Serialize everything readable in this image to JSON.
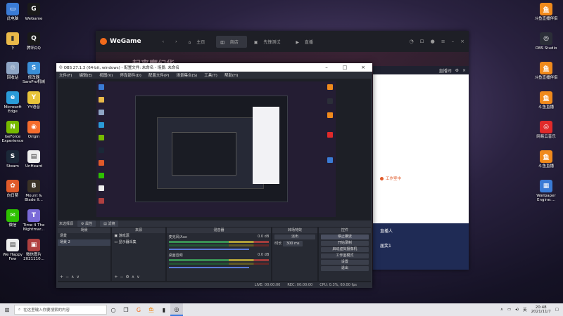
{
  "desktop_left_icons": [
    {
      "label": "此电脑",
      "icon": "computer-icon",
      "color": "#3a7bd5",
      "glyph": "▭"
    },
    {
      "label": "WeGame",
      "icon": "wegame-icon",
      "color": "#1a1a1a",
      "glyph": "G"
    },
    {
      "label": "下",
      "icon": "folder-icon",
      "color": "#e9b949",
      "glyph": "▮"
    },
    {
      "label": "腾讯QQ",
      "icon": "qq-icon",
      "color": "#1a1a1a",
      "glyph": "Q"
    },
    {
      "label": "回收站",
      "icon": "recycle-bin-icon",
      "color": "#8fa6c5",
      "glyph": "♲"
    },
    {
      "label": "修改器 SamPro机械",
      "icon": "tool-icon",
      "color": "#3a8fd8",
      "glyph": "S"
    },
    {
      "label": "Microsoft Edge",
      "icon": "edge-icon",
      "color": "#2a9bd8",
      "glyph": "e"
    },
    {
      "label": "YY语音",
      "icon": "yy-icon",
      "color": "#e8c43a",
      "glyph": "Y"
    },
    {
      "label": "GeForce Experience",
      "icon": "nvidia-icon",
      "color": "#76b900",
      "glyph": "N"
    },
    {
      "label": "Origin",
      "icon": "origin-icon",
      "color": "#f56c2d",
      "glyph": "◉"
    },
    {
      "label": "Steam",
      "icon": "steam-icon",
      "color": "#1b2838",
      "glyph": "S"
    },
    {
      "label": "UnHeard",
      "icon": "document-icon",
      "color": "#eeeeee",
      "glyph": "▤"
    },
    {
      "label": "向日葵",
      "icon": "sunflower-icon",
      "color": "#e05a2a",
      "glyph": "✿"
    },
    {
      "label": "Mount & Blade II...",
      "icon": "bannerlord-icon",
      "color": "#3a3226",
      "glyph": "B"
    },
    {
      "label": "微信",
      "icon": "wechat-icon",
      "color": "#2dc100",
      "glyph": "✉"
    },
    {
      "label": "Time 4 The Nightmar...",
      "icon": "game-icon",
      "color": "#7a6ad8",
      "glyph": "T"
    },
    {
      "label": "We Happy Few",
      "icon": "document-icon",
      "color": "#eeeeee",
      "glyph": "▤"
    },
    {
      "label": "微信图片 2021110...",
      "icon": "image-icon",
      "color": "#b04040",
      "glyph": "▣"
    }
  ],
  "desktop_right_icons": [
    {
      "label": "斗鱼直播伴侣",
      "icon": "douyu-icon",
      "color": "#f08a1c",
      "glyph": "鱼"
    },
    {
      "label": "OBS Studio",
      "icon": "obs-icon",
      "color": "#2b2e38",
      "glyph": "◎"
    },
    {
      "label": "斗鱼直播伴侣",
      "icon": "douyu-icon",
      "color": "#f08a1c",
      "glyph": "鱼"
    },
    {
      "label": "斗鱼直播",
      "icon": "douyu-icon",
      "color": "#f08a1c",
      "glyph": "鱼"
    },
    {
      "label": "网易云音乐",
      "icon": "netease-music-icon",
      "color": "#e02a2a",
      "glyph": "◎"
    },
    {
      "label": "斗鱼直播",
      "icon": "douyu-icon",
      "color": "#f08a1c",
      "glyph": "鱼"
    },
    {
      "label": "Wallpaper Engine:...",
      "icon": "wallpaper-engine-icon",
      "color": "#3a7bd5",
      "glyph": "▦"
    }
  ],
  "wegame": {
    "logo": "WeGame",
    "tabs": [
      "主页",
      "商店",
      "先锋测试",
      "直播"
    ],
    "active_tab": "商店",
    "banner": "一起来魔幻华"
  },
  "live_panel": {
    "status": "工作室中",
    "menu": [
      "直播人",
      "届奖1"
    ]
  },
  "obs": {
    "title": "OBS 27.1.3 (64-bit, windows) - 配置文件: 未命名 - 场景: 未命名",
    "menu": [
      "文件(F)",
      "编辑(E)",
      "视图(V)",
      "停靠部件(D)",
      "配置文件(P)",
      "场景集合(S)",
      "工具(T)",
      "帮助(H)"
    ],
    "scene_bar": "未选择源",
    "properties_btn": "属性",
    "filters_btn": "滤镜",
    "docks": {
      "scenes": {
        "title": "场景",
        "items": [
          "场景",
          "场景 2"
        ]
      },
      "sources": {
        "title": "来源",
        "items": [
          "游戏源",
          "显示器采集"
        ]
      },
      "mixer": {
        "title": "混音器",
        "channels": [
          {
            "name": "麦克风/Aux",
            "db": "0.0 dB"
          },
          {
            "name": "桌面音频",
            "db": "0.0 dB"
          }
        ]
      },
      "transitions": {
        "title": "转场特效",
        "type": "淡出",
        "duration_label": "时长",
        "duration": "300 ms"
      },
      "controls": {
        "title": "控件",
        "buttons": [
          "停止推流",
          "开始录制",
          "启动虚拟摄像机",
          "工作室模式",
          "设置",
          "退出"
        ]
      }
    },
    "status": [
      "LIVE: 00:00:00",
      "REC: 00:00:00",
      "CPU: 0.3%, 60.00 fps"
    ]
  },
  "taskbar": {
    "search_placeholder": "在这里输入你要搜索的内容",
    "time": "20:48",
    "date": "2021/11/7",
    "ime": "英"
  }
}
